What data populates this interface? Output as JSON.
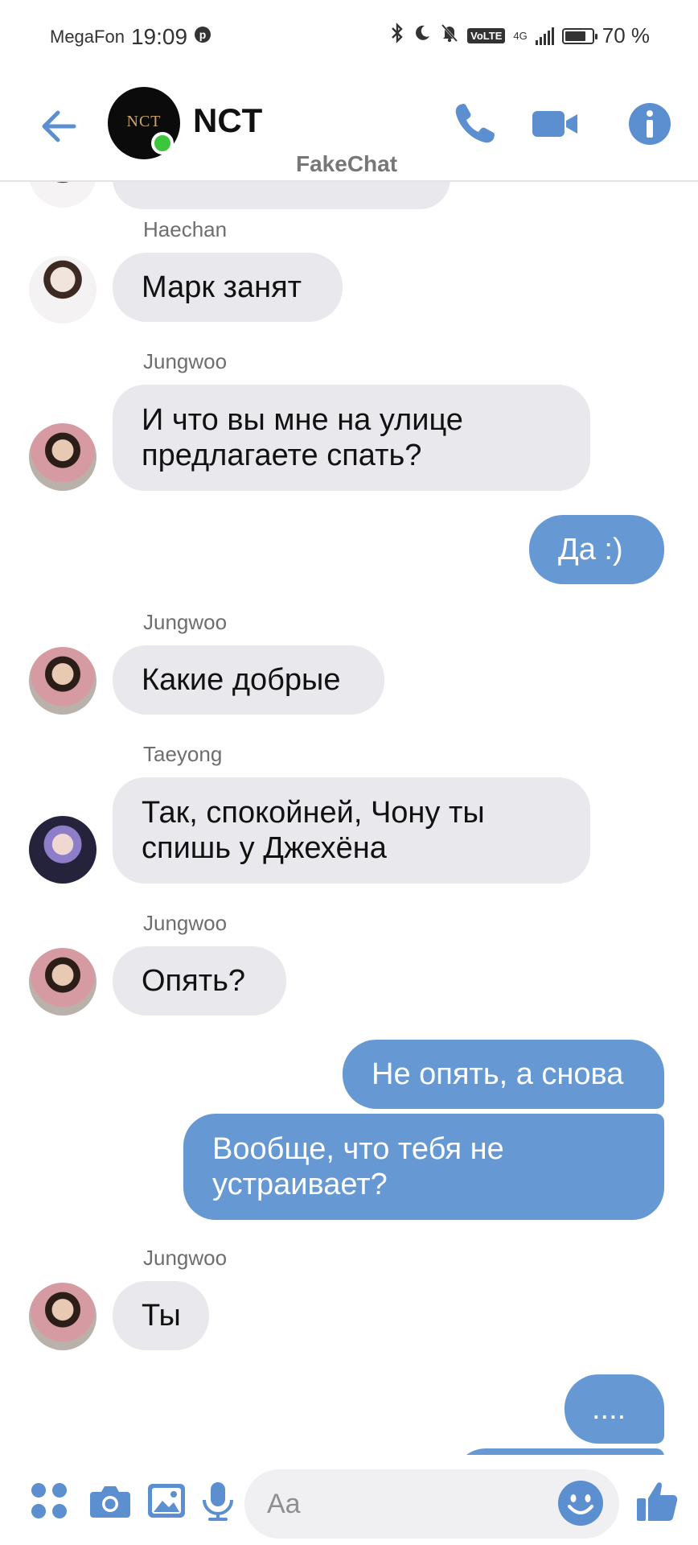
{
  "status": {
    "carrier": "MegaFon",
    "time": "19:09",
    "volte": "VoLTE",
    "network": "4G",
    "battery": "70 %"
  },
  "header": {
    "title": "NCT",
    "avatar_text": "NCT",
    "watermark": "FakeChat"
  },
  "messages": [
    {
      "sender": "Haechan",
      "text": "Марк занят"
    },
    {
      "sender": "Jungwoo",
      "text": "И что вы мне на улице\nпредлагаете спать?"
    },
    {
      "sender": "me",
      "text": "Да :)"
    },
    {
      "sender": "Jungwoo",
      "text": "Какие добрые"
    },
    {
      "sender": "Taeyong",
      "text": "Так, спокойней, Чону ты\nспишь у Джехёна"
    },
    {
      "sender": "Jungwoo",
      "text": "Опять?"
    },
    {
      "sender": "me",
      "text": "Не опять, а снова"
    },
    {
      "sender": "me",
      "text": "Вообще, что тебя не\nустраивает?"
    },
    {
      "sender": "Jungwoo",
      "text": "Ты"
    },
    {
      "sender": "me",
      "text": "...."
    }
  ],
  "composer": {
    "placeholder": "Aa"
  },
  "colors": {
    "accent": "#5b8fd0",
    "outgoing_bubble": "#6699d4",
    "incoming_bubble": "#e9e9ed",
    "online": "#3ec53e"
  }
}
